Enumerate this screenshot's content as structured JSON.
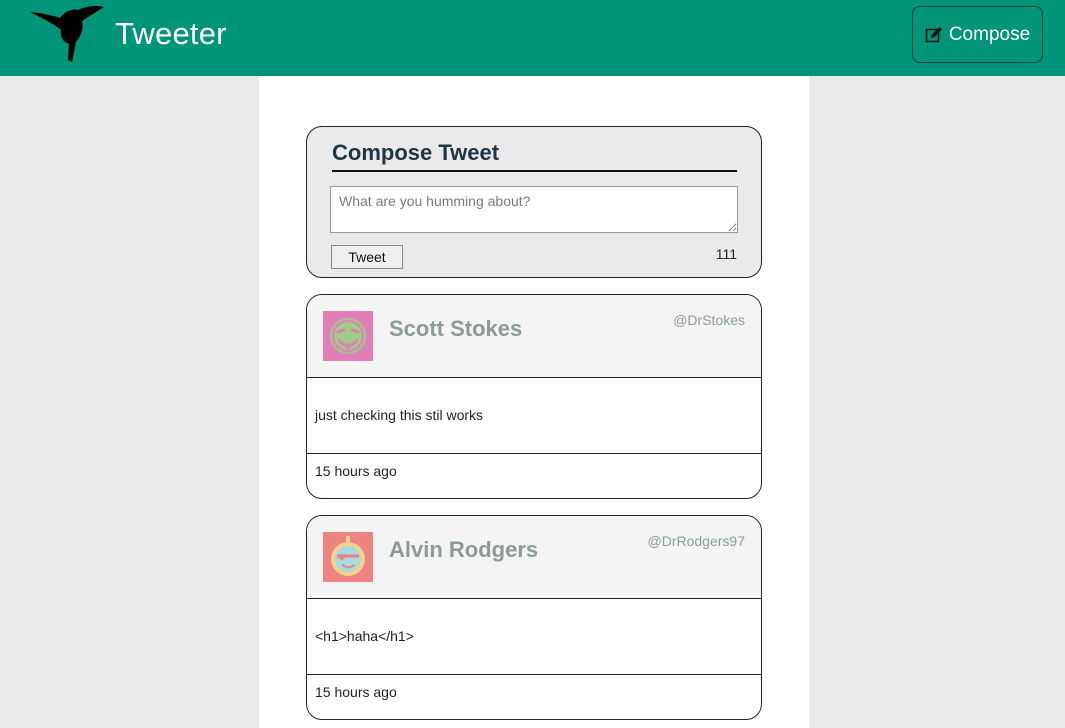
{
  "nav": {
    "brand": "Tweeter",
    "compose_label": "Compose",
    "logo_icon": "hummingbird-icon",
    "compose_icon": "pencil-square-icon",
    "bg_color": "#009578"
  },
  "compose": {
    "title": "Compose Tweet",
    "placeholder": "What are you humming about?",
    "button_label": "Tweet",
    "counter": "111"
  },
  "tweets": [
    {
      "name": "Scott Stokes",
      "handle": "@DrStokes",
      "text": "just checking this stil works",
      "time": "15 hours ago",
      "avatar_bg": "#e07fb8",
      "avatar_fg": "#9ecb86"
    },
    {
      "name": "Alvin Rodgers",
      "handle": "@DrRodgers97",
      "text": "<h1>haha</h1>",
      "time": "15 hours ago",
      "avatar_bg": "#ef8282",
      "avatar_fg": "#f5d38a"
    }
  ]
}
